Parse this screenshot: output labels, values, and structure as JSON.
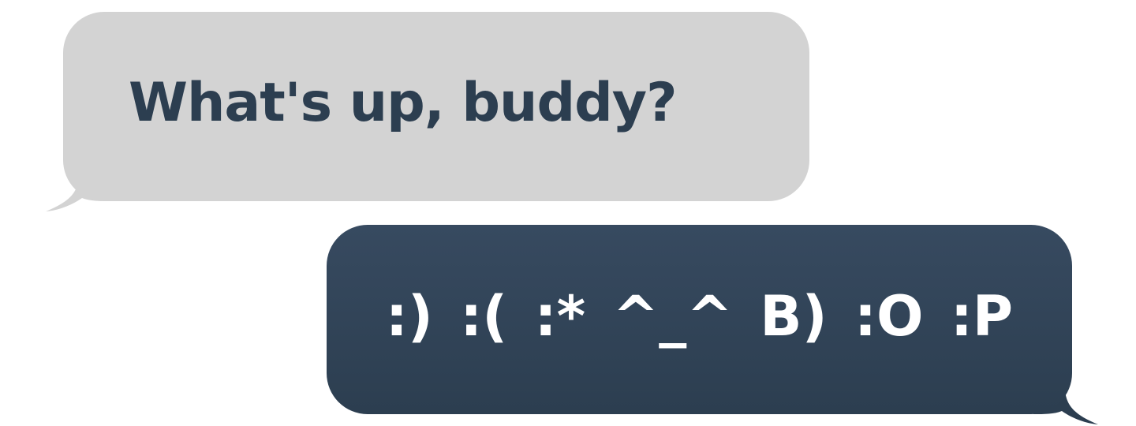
{
  "messages": {
    "incoming": {
      "text": "What's up, buddy?",
      "bubble_color": "#d3d3d3",
      "text_color": "#2c3e50"
    },
    "outgoing": {
      "text": ":) :( :* ^_^ B) :O :P",
      "bubble_color": "#2c3e50",
      "text_color": "#ffffff"
    }
  }
}
